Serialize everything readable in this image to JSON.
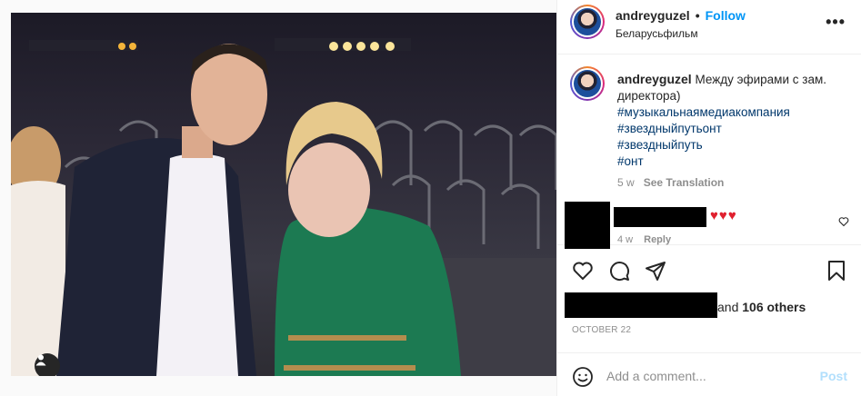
{
  "post": {
    "username": "andreyguzel",
    "separator": "•",
    "follow_label": "Follow",
    "location": "Беларусьфильм",
    "more_label": "•••"
  },
  "caption": {
    "username": "andreyguzel",
    "text": "Между эфирами с зам. директора)",
    "hashtags": [
      "#музыкальнаямедиакомпания",
      "#звездныйпутьонт",
      "#звездныйпуть",
      "#онт"
    ],
    "age": "5 w",
    "translate_label": "See Translation"
  },
  "comment": {
    "hearts": "♥♥♥",
    "age": "4 w",
    "reply_label": "Reply"
  },
  "likes": {
    "prefix": "and",
    "count_label": "106 others"
  },
  "date": "OCTOBER 22",
  "add_comment": {
    "placeholder": "Add a comment...",
    "post_label": "Post"
  },
  "colors": {
    "follow": "#0095f6",
    "hashtag": "#00376b",
    "muted": "#8e8e8e",
    "heart": "#e0202e",
    "post_disabled": "#b2dffc"
  },
  "icons": [
    "heart-icon",
    "comment-icon",
    "share-icon",
    "bookmark-icon",
    "emoji-icon",
    "user-tag-icon",
    "more-icon"
  ]
}
